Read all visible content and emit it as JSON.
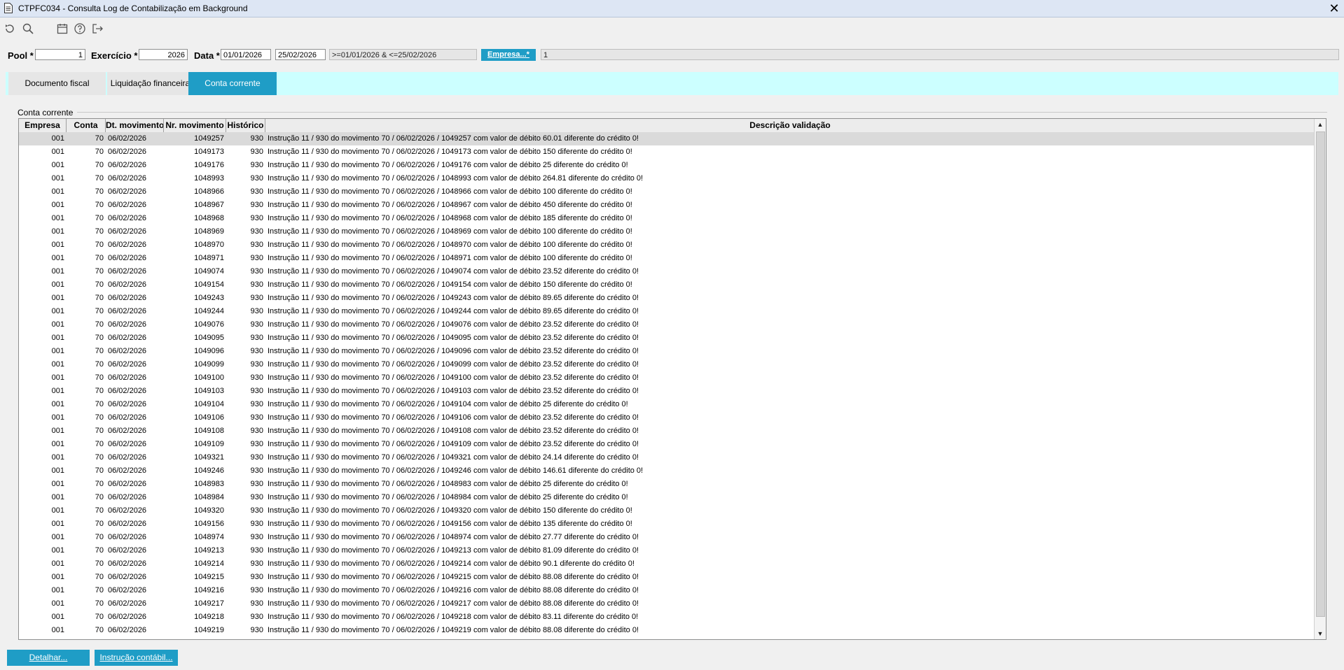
{
  "window": {
    "title": "CTPFC034 - Consulta Log de Contabilização em Background",
    "close_label": "✕"
  },
  "toolbar": {
    "icons": [
      "refresh-icon",
      "search-icon",
      "calendar-icon",
      "help-icon",
      "exit-icon"
    ]
  },
  "filters": {
    "pool_label": "Pool *",
    "pool_value": "1",
    "exercicio_label": "Exercício *",
    "exercicio_value": "2026",
    "data_label": "Data *",
    "data_from": "01/01/2026",
    "data_to": "25/02/2026",
    "data_expression": ">=01/01/2026 & <=25/02/2026",
    "empresa_button": "Empresa...*",
    "empresa_value": "1"
  },
  "tabs": [
    {
      "label": "Documento fiscal",
      "active": false
    },
    {
      "label": "Liquidação financeira",
      "active": false
    },
    {
      "label": "Conta corrente",
      "active": true
    }
  ],
  "section": {
    "title": "Conta corrente"
  },
  "table": {
    "columns": [
      "Empresa",
      "Conta",
      "Dt. movimento",
      "Nr. movimento",
      "Histórico",
      "Descrição validação"
    ],
    "rows": [
      [
        "001",
        "70",
        "06/02/2026",
        "1049257",
        "930",
        "Instrução 11 / 930 do movimento 70 / 06/02/2026 / 1049257 com valor de débito 60.01 diferente do crédito 0!"
      ],
      [
        "001",
        "70",
        "06/02/2026",
        "1049173",
        "930",
        "Instrução 11 / 930 do movimento 70 / 06/02/2026 / 1049173 com valor de débito 150 diferente do crédito 0!"
      ],
      [
        "001",
        "70",
        "06/02/2026",
        "1049176",
        "930",
        "Instrução 11 / 930 do movimento 70 / 06/02/2026 / 1049176 com valor de débito 25 diferente do crédito 0!"
      ],
      [
        "001",
        "70",
        "06/02/2026",
        "1048993",
        "930",
        "Instrução 11 / 930 do movimento 70 / 06/02/2026 / 1048993 com valor de débito 264.81 diferente do crédito 0!"
      ],
      [
        "001",
        "70",
        "06/02/2026",
        "1048966",
        "930",
        "Instrução 11 / 930 do movimento 70 / 06/02/2026 / 1048966 com valor de débito 100 diferente do crédito 0!"
      ],
      [
        "001",
        "70",
        "06/02/2026",
        "1048967",
        "930",
        "Instrução 11 / 930 do movimento 70 / 06/02/2026 / 1048967 com valor de débito 450 diferente do crédito 0!"
      ],
      [
        "001",
        "70",
        "06/02/2026",
        "1048968",
        "930",
        "Instrução 11 / 930 do movimento 70 / 06/02/2026 / 1048968 com valor de débito 185 diferente do crédito 0!"
      ],
      [
        "001",
        "70",
        "06/02/2026",
        "1048969",
        "930",
        "Instrução 11 / 930 do movimento 70 / 06/02/2026 / 1048969 com valor de débito 100 diferente do crédito 0!"
      ],
      [
        "001",
        "70",
        "06/02/2026",
        "1048970",
        "930",
        "Instrução 11 / 930 do movimento 70 / 06/02/2026 / 1048970 com valor de débito 100 diferente do crédito 0!"
      ],
      [
        "001",
        "70",
        "06/02/2026",
        "1048971",
        "930",
        "Instrução 11 / 930 do movimento 70 / 06/02/2026 / 1048971 com valor de débito 100 diferente do crédito 0!"
      ],
      [
        "001",
        "70",
        "06/02/2026",
        "1049074",
        "930",
        "Instrução 11 / 930 do movimento 70 / 06/02/2026 / 1049074 com valor de débito 23.52 diferente do crédito 0!"
      ],
      [
        "001",
        "70",
        "06/02/2026",
        "1049154",
        "930",
        "Instrução 11 / 930 do movimento 70 / 06/02/2026 / 1049154 com valor de débito 150 diferente do crédito 0!"
      ],
      [
        "001",
        "70",
        "06/02/2026",
        "1049243",
        "930",
        "Instrução 11 / 930 do movimento 70 / 06/02/2026 / 1049243 com valor de débito 89.65 diferente do crédito 0!"
      ],
      [
        "001",
        "70",
        "06/02/2026",
        "1049244",
        "930",
        "Instrução 11 / 930 do movimento 70 / 06/02/2026 / 1049244 com valor de débito 89.65 diferente do crédito 0!"
      ],
      [
        "001",
        "70",
        "06/02/2026",
        "1049076",
        "930",
        "Instrução 11 / 930 do movimento 70 / 06/02/2026 / 1049076 com valor de débito 23.52 diferente do crédito 0!"
      ],
      [
        "001",
        "70",
        "06/02/2026",
        "1049095",
        "930",
        "Instrução 11 / 930 do movimento 70 / 06/02/2026 / 1049095 com valor de débito 23.52 diferente do crédito 0!"
      ],
      [
        "001",
        "70",
        "06/02/2026",
        "1049096",
        "930",
        "Instrução 11 / 930 do movimento 70 / 06/02/2026 / 1049096 com valor de débito 23.52 diferente do crédito 0!"
      ],
      [
        "001",
        "70",
        "06/02/2026",
        "1049099",
        "930",
        "Instrução 11 / 930 do movimento 70 / 06/02/2026 / 1049099 com valor de débito 23.52 diferente do crédito 0!"
      ],
      [
        "001",
        "70",
        "06/02/2026",
        "1049100",
        "930",
        "Instrução 11 / 930 do movimento 70 / 06/02/2026 / 1049100 com valor de débito 23.52 diferente do crédito 0!"
      ],
      [
        "001",
        "70",
        "06/02/2026",
        "1049103",
        "930",
        "Instrução 11 / 930 do movimento 70 / 06/02/2026 / 1049103 com valor de débito 23.52 diferente do crédito 0!"
      ],
      [
        "001",
        "70",
        "06/02/2026",
        "1049104",
        "930",
        "Instrução 11 / 930 do movimento 70 / 06/02/2026 / 1049104 com valor de débito 25 diferente do crédito 0!"
      ],
      [
        "001",
        "70",
        "06/02/2026",
        "1049106",
        "930",
        "Instrução 11 / 930 do movimento 70 / 06/02/2026 / 1049106 com valor de débito 23.52 diferente do crédito 0!"
      ],
      [
        "001",
        "70",
        "06/02/2026",
        "1049108",
        "930",
        "Instrução 11 / 930 do movimento 70 / 06/02/2026 / 1049108 com valor de débito 23.52 diferente do crédito 0!"
      ],
      [
        "001",
        "70",
        "06/02/2026",
        "1049109",
        "930",
        "Instrução 11 / 930 do movimento 70 / 06/02/2026 / 1049109 com valor de débito 23.52 diferente do crédito 0!"
      ],
      [
        "001",
        "70",
        "06/02/2026",
        "1049321",
        "930",
        "Instrução 11 / 930 do movimento 70 / 06/02/2026 / 1049321 com valor de débito 24.14 diferente do crédito 0!"
      ],
      [
        "001",
        "70",
        "06/02/2026",
        "1049246",
        "930",
        "Instrução 11 / 930 do movimento 70 / 06/02/2026 / 1049246 com valor de débito 146.61 diferente do crédito 0!"
      ],
      [
        "001",
        "70",
        "06/02/2026",
        "1048983",
        "930",
        "Instrução 11 / 930 do movimento 70 / 06/02/2026 / 1048983 com valor de débito 25 diferente do crédito 0!"
      ],
      [
        "001",
        "70",
        "06/02/2026",
        "1048984",
        "930",
        "Instrução 11 / 930 do movimento 70 / 06/02/2026 / 1048984 com valor de débito 25 diferente do crédito 0!"
      ],
      [
        "001",
        "70",
        "06/02/2026",
        "1049320",
        "930",
        "Instrução 11 / 930 do movimento 70 / 06/02/2026 / 1049320 com valor de débito 150 diferente do crédito 0!"
      ],
      [
        "001",
        "70",
        "06/02/2026",
        "1049156",
        "930",
        "Instrução 11 / 930 do movimento 70 / 06/02/2026 / 1049156 com valor de débito 135 diferente do crédito 0!"
      ],
      [
        "001",
        "70",
        "06/02/2026",
        "1048974",
        "930",
        "Instrução 11 / 930 do movimento 70 / 06/02/2026 / 1048974 com valor de débito 27.77 diferente do crédito 0!"
      ],
      [
        "001",
        "70",
        "06/02/2026",
        "1049213",
        "930",
        "Instrução 11 / 930 do movimento 70 / 06/02/2026 / 1049213 com valor de débito 81.09 diferente do crédito 0!"
      ],
      [
        "001",
        "70",
        "06/02/2026",
        "1049214",
        "930",
        "Instrução 11 / 930 do movimento 70 / 06/02/2026 / 1049214 com valor de débito 90.1 diferente do crédito 0!"
      ],
      [
        "001",
        "70",
        "06/02/2026",
        "1049215",
        "930",
        "Instrução 11 / 930 do movimento 70 / 06/02/2026 / 1049215 com valor de débito 88.08 diferente do crédito 0!"
      ],
      [
        "001",
        "70",
        "06/02/2026",
        "1049216",
        "930",
        "Instrução 11 / 930 do movimento 70 / 06/02/2026 / 1049216 com valor de débito 88.08 diferente do crédito 0!"
      ],
      [
        "001",
        "70",
        "06/02/2026",
        "1049217",
        "930",
        "Instrução 11 / 930 do movimento 70 / 06/02/2026 / 1049217 com valor de débito 88.08 diferente do crédito 0!"
      ],
      [
        "001",
        "70",
        "06/02/2026",
        "1049218",
        "930",
        "Instrução 11 / 930 do movimento 70 / 06/02/2026 / 1049218 com valor de débito 83.11 diferente do crédito 0!"
      ],
      [
        "001",
        "70",
        "06/02/2026",
        "1049219",
        "930",
        "Instrução 11 / 930 do movimento 70 / 06/02/2026 / 1049219 com valor de débito 88.08 diferente do crédito 0!"
      ]
    ]
  },
  "scrollbar": {
    "up_arrow": "▲",
    "down_arrow": "▼"
  },
  "actions": {
    "detalhar_label": "Detalhar...",
    "instrucao_label": "Instrução contábil..."
  }
}
